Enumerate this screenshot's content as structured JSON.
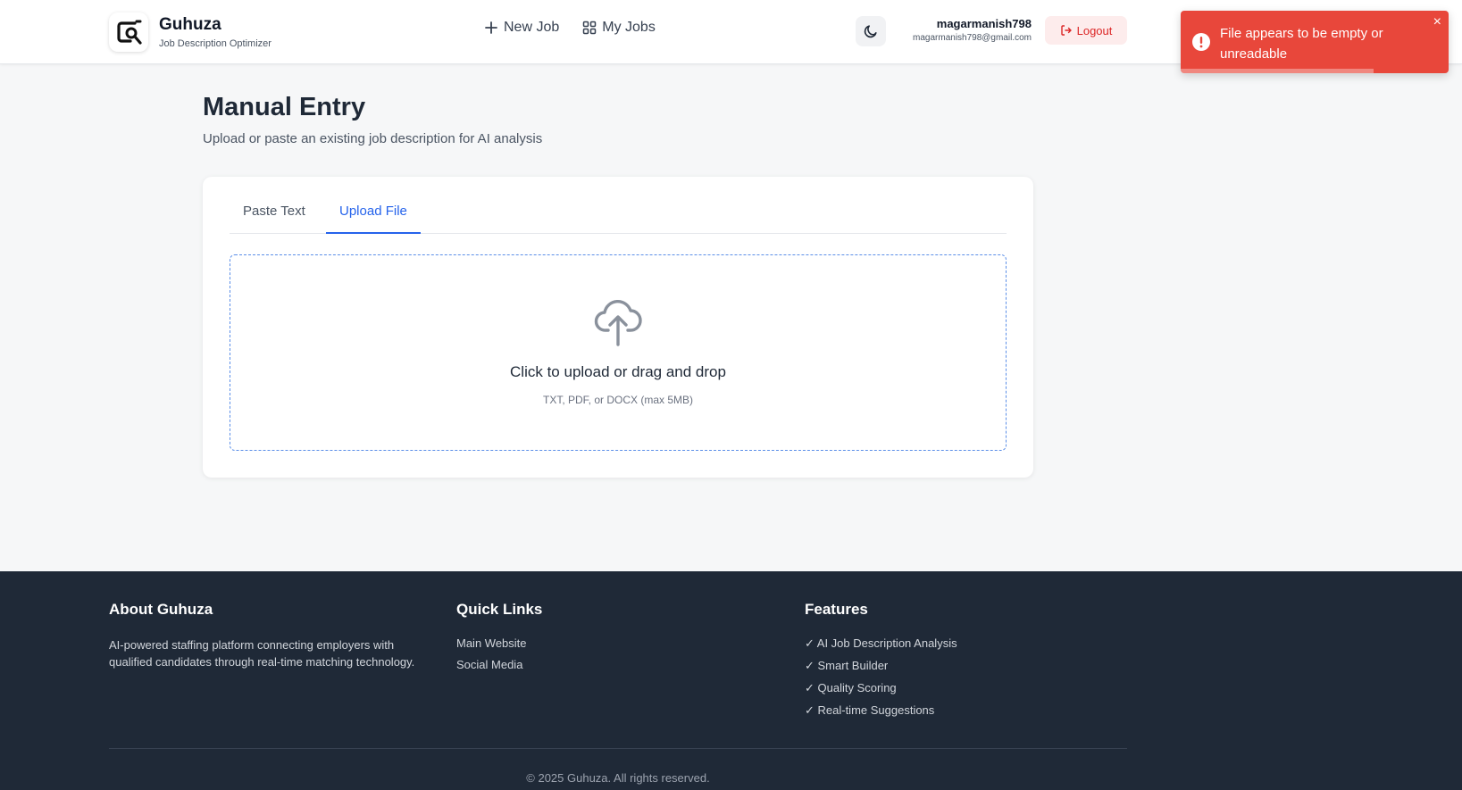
{
  "header": {
    "brand_name": "Guhuza",
    "brand_sub": "Job Description Optimizer",
    "nav": [
      {
        "label": "New Job",
        "icon": "plus-icon"
      },
      {
        "label": "My Jobs",
        "icon": "grid-icon"
      }
    ],
    "theme_icon": "moon-icon",
    "user_name": "magarmanish798",
    "user_email": "magarmanish798@gmail.com",
    "logout_label": "Logout"
  },
  "toast": {
    "message": "File appears to be empty or unreadable",
    "close": "×",
    "color": "#e8473b",
    "progress_percent": 72
  },
  "main": {
    "title": "Manual Entry",
    "subtitle": "Upload or paste an existing job description for AI analysis",
    "tabs": [
      {
        "label": "Paste Text",
        "active": false
      },
      {
        "label": "Upload File",
        "active": true
      }
    ],
    "dropzone": {
      "title": "Click to upload or drag and drop",
      "hint": "TXT, PDF, or DOCX (max 5MB)"
    },
    "accent": "#2563eb"
  },
  "footer": {
    "about": {
      "heading": "About Guhuza",
      "text": "AI-powered staffing platform connecting employers with qualified candidates through real-time matching technology."
    },
    "links": {
      "heading": "Quick Links",
      "items": [
        "Main Website",
        "Social Media"
      ]
    },
    "features": {
      "heading": "Features",
      "items": [
        "✓ AI Job Description Analysis",
        "✓ Smart Builder",
        "✓ Quality Scoring",
        "✓ Real-time Suggestions"
      ]
    },
    "copyright": "© 2025 Guhuza. All rights reserved."
  }
}
